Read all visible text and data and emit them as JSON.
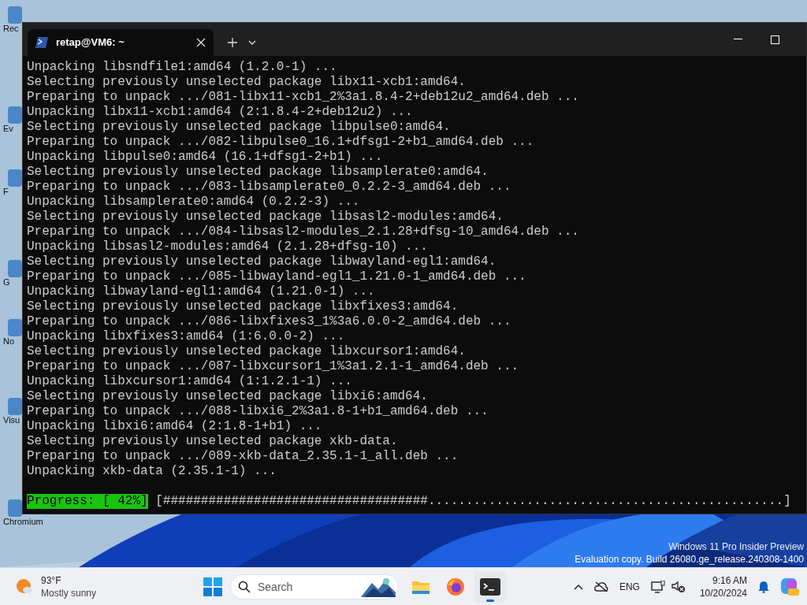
{
  "desktop": {
    "icons": [
      {
        "label": "Rec"
      },
      {
        "label": "Ev"
      },
      {
        "label": "F"
      },
      {
        "label": "G"
      },
      {
        "label": "No"
      },
      {
        "label": "Visu"
      },
      {
        "label": "Chromium"
      }
    ],
    "watermark": [
      "Windows 11 Pro Insider Preview",
      "Evaluation copy. Build 26080.ge_release.240308-1400"
    ]
  },
  "terminal": {
    "tabs": [
      {
        "title": "retap@VM6: ~",
        "selected": true
      }
    ],
    "lines": [
      "Unpacking libsndfile1:amd64 (1.2.0-1) ...",
      "Selecting previously unselected package libx11-xcb1:amd64.",
      "Preparing to unpack .../081-libx11-xcb1_2%3a1.8.4-2+deb12u2_amd64.deb ...",
      "Unpacking libx11-xcb1:amd64 (2:1.8.4-2+deb12u2) ...",
      "Selecting previously unselected package libpulse0:amd64.",
      "Preparing to unpack .../082-libpulse0_16.1+dfsg1-2+b1_amd64.deb ...",
      "Unpacking libpulse0:amd64 (16.1+dfsg1-2+b1) ...",
      "Selecting previously unselected package libsamplerate0:amd64.",
      "Preparing to unpack .../083-libsamplerate0_0.2.2-3_amd64.deb ...",
      "Unpacking libsamplerate0:amd64 (0.2.2-3) ...",
      "Selecting previously unselected package libsasl2-modules:amd64.",
      "Preparing to unpack .../084-libsasl2-modules_2.1.28+dfsg-10_amd64.deb ...",
      "Unpacking libsasl2-modules:amd64 (2.1.28+dfsg-10) ...",
      "Selecting previously unselected package libwayland-egl1:amd64.",
      "Preparing to unpack .../085-libwayland-egl1_1.21.0-1_amd64.deb ...",
      "Unpacking libwayland-egl1:amd64 (1.21.0-1) ...",
      "Selecting previously unselected package libxfixes3:amd64.",
      "Preparing to unpack .../086-libxfixes3_1%3a6.0.0-2_amd64.deb ...",
      "Unpacking libxfixes3:amd64 (1:6.0.0-2) ...",
      "Selecting previously unselected package libxcursor1:amd64.",
      "Preparing to unpack .../087-libxcursor1_1%3a1.2.1-1_amd64.deb ...",
      "Unpacking libxcursor1:amd64 (1:1.2.1-1) ...",
      "Selecting previously unselected package libxi6:amd64.",
      "Preparing to unpack .../088-libxi6_2%3a1.8-1+b1_amd64.deb ...",
      "Unpacking libxi6:amd64 (2:1.8-1+b1) ...",
      "Selecting previously unselected package xkb-data.",
      "Preparing to unpack .../089-xkb-data_2.35.1-1_all.deb ...",
      "Unpacking xkb-data (2.35.1-1) ..."
    ],
    "progress": {
      "label": "Progress: [ 42%]",
      "bar": "[###################################...............................................]"
    }
  },
  "taskbar": {
    "weather": {
      "temperature": "93°F",
      "condition": "Mostly sunny"
    },
    "search": {
      "placeholder": "Search"
    },
    "apps": [
      {
        "kind": "folder",
        "selected": false
      },
      {
        "kind": "firefox",
        "selected": false
      },
      {
        "kind": "terminal",
        "selected": true
      }
    ],
    "tray": {
      "language": "ENG",
      "time": "9:16 AM",
      "date": "10/20/2024"
    }
  }
}
